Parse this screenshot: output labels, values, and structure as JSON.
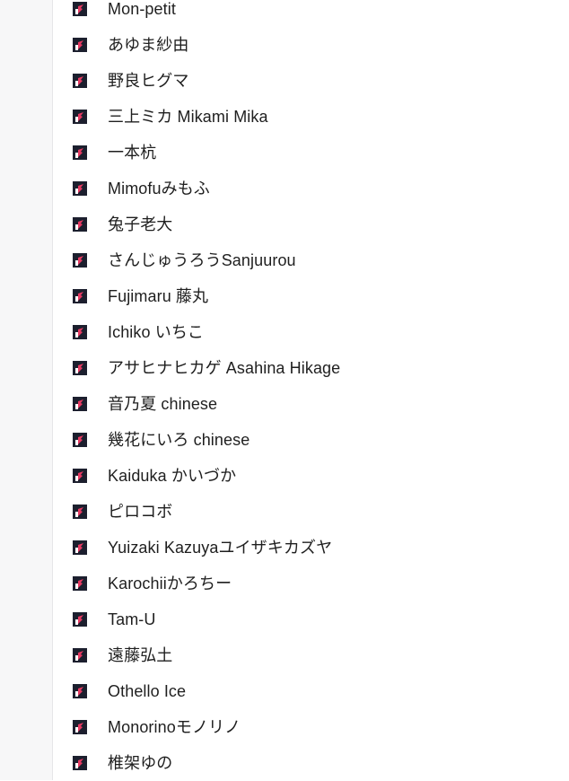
{
  "list": {
    "items": [
      {
        "label": "Mon-petit"
      },
      {
        "label": "あゆま紗由"
      },
      {
        "label": "野良ヒグマ"
      },
      {
        "label": "三上ミカ Mikami Mika"
      },
      {
        "label": "一本杭"
      },
      {
        "label": "Mimofuみもふ"
      },
      {
        "label": "兔子老大"
      },
      {
        "label": "さんじゅうろうSanjuurou"
      },
      {
        "label": "Fujimaru 藤丸"
      },
      {
        "label": "Ichiko いちこ"
      },
      {
        "label": "アサヒナヒカゲ Asahina Hikage"
      },
      {
        "label": "音乃夏 chinese"
      },
      {
        "label": "幾花にいろ chinese"
      },
      {
        "label": "Kaiduka かいづか"
      },
      {
        "label": "ピロコボ"
      },
      {
        "label": "Yuizaki Kazuyaユイザキカズヤ"
      },
      {
        "label": "Karochiiかろちー"
      },
      {
        "label": "Tam-U"
      },
      {
        "label": "遠藤弘土"
      },
      {
        "label": "Othello Ice"
      },
      {
        "label": "Monorinoモノリノ"
      },
      {
        "label": "椎架ゆの"
      }
    ],
    "icon": "site-favicon-icon",
    "colors": {
      "icon_bg": "#1c1f2e",
      "icon_accent": "#e83a63",
      "text": "#1f1f1f",
      "gutter": "#f7f7f8"
    }
  }
}
